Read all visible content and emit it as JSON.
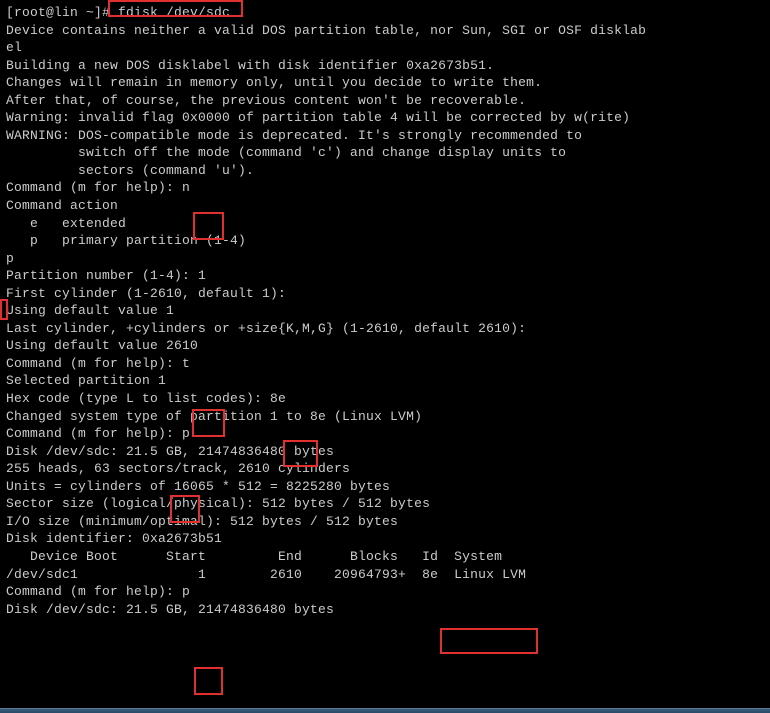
{
  "prompt": "[root@lin ~]# ",
  "cmd": "fdisk /dev/sdc",
  "out": {
    "l1": "Device contains neither a valid DOS partition table, nor Sun, SGI or OSF disklab",
    "l2": "el",
    "l3": "Building a new DOS disklabel with disk identifier 0xa2673b51.",
    "l4": "Changes will remain in memory only, until you decide to write them.",
    "l5": "After that, of course, the previous content won't be recoverable.",
    "l6": "",
    "l7": "Warning: invalid flag 0x0000 of partition table 4 will be corrected by w(rite)",
    "l8": "",
    "l9": "WARNING: DOS-compatible mode is deprecated. It's strongly recommended to",
    "l10": "         switch off the mode (command 'c') and change display units to",
    "l11": "         sectors (command 'u').",
    "l12": "",
    "p_help": "Command (m for help): ",
    "in_n": "n",
    "l13": "Command action",
    "l14": "   e   extended",
    "l15": "   p   primary partition (1-4)",
    "in_p1": "p",
    "l16": "Partition number (1-4): 1",
    "l17": "First cylinder (1-2610, default 1):",
    "l18": "Using default value 1",
    "l19": "Last cylinder, +cylinders or +size{K,M,G} (1-2610, default 2610):",
    "l20": "Using default value 2610",
    "l21": "",
    "in_t": "t",
    "l22": "Selected partition 1",
    "l23_p": "Hex code (type L to list codes): ",
    "in_8e": "8e",
    "l24": "Changed system type of partition 1 to 8e (Linux LVM)",
    "l25": "",
    "in_pp": "p",
    "l26": "",
    "l27": "Disk /dev/sdc: 21.5 GB, 21474836480 bytes",
    "l28": "255 heads, 63 sectors/track, 2610 cylinders",
    "l29": "Units = cylinders of 16065 * 512 = 8225280 bytes",
    "l30": "Sector size (logical/physical): 512 bytes / 512 bytes",
    "l31": "I/O size (minimum/optimal): 512 bytes / 512 bytes",
    "l32": "Disk identifier: 0xa2673b51",
    "l33": "",
    "l34": "   Device Boot      Start         End      Blocks   Id  System",
    "l35": "/dev/sdc1               1        2610    20964793+  8e  Linux LVM",
    "l36": "",
    "in_pp2": "p",
    "l37": "",
    "l38": "Disk /dev/sdc: 21.5 GB, 21474836480 bytes"
  }
}
